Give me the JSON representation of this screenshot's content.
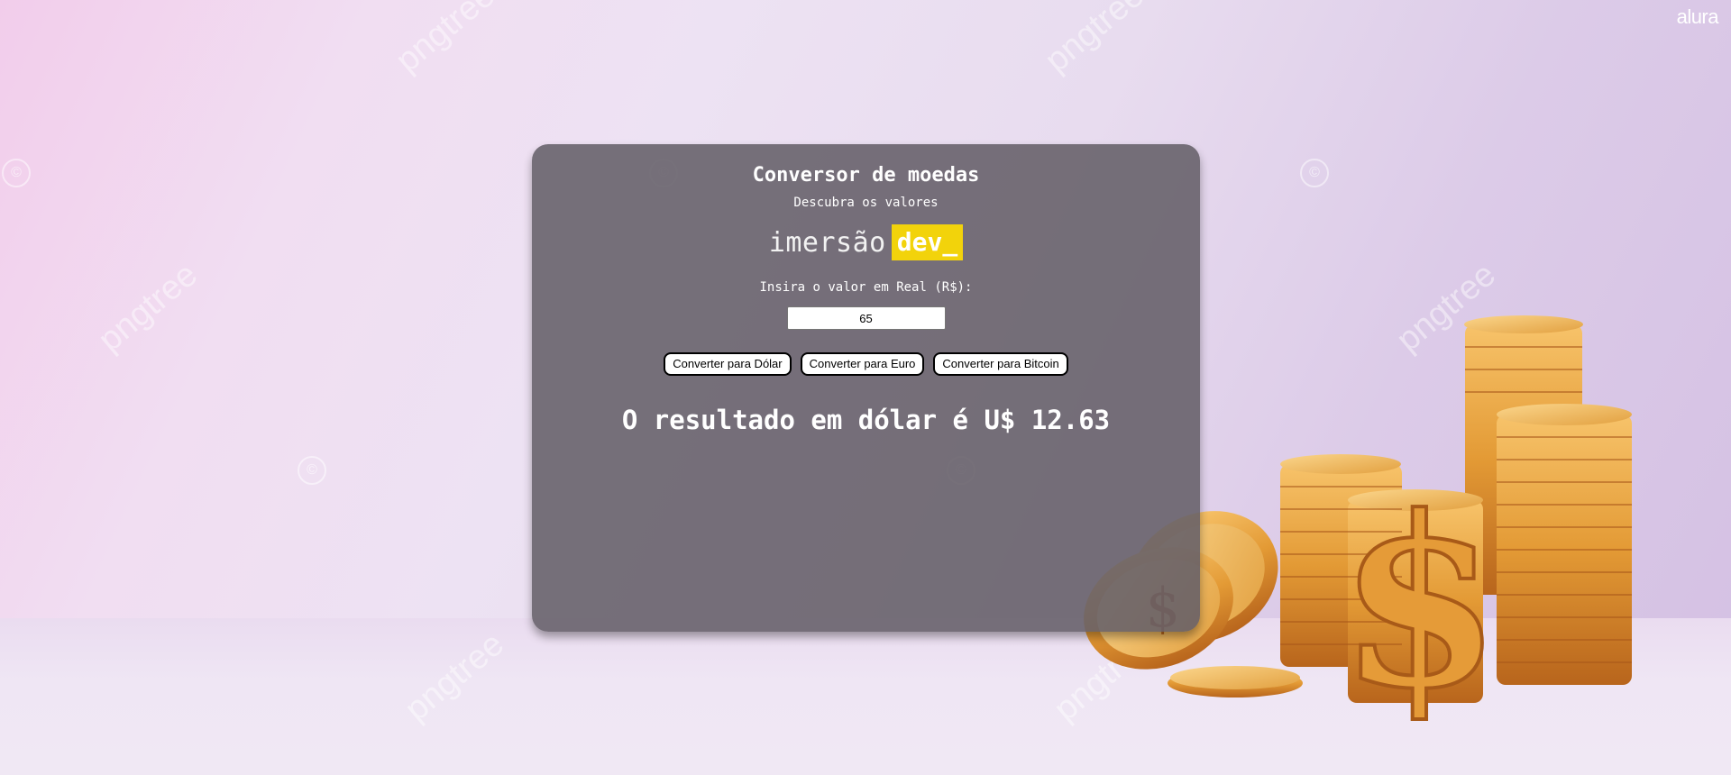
{
  "brand": {
    "name": "alura"
  },
  "watermark": {
    "text": "pngtree"
  },
  "card": {
    "title": "Conversor de moedas",
    "subtitle": "Descubra os valores",
    "logo_word": "imersão",
    "logo_tag": "dev_",
    "prompt": "Insira o valor em Real (R$):",
    "input_value": "65",
    "buttons": {
      "dollar": "Converter para Dólar",
      "euro": "Converter para Euro",
      "bitcoin": "Converter para Bitcoin"
    },
    "result": "O resultado em dólar é U$ 12.63"
  },
  "colors": {
    "card_bg": "#645e68",
    "logo_accent": "#f2d30b",
    "coin_gold": "#e39a35"
  }
}
